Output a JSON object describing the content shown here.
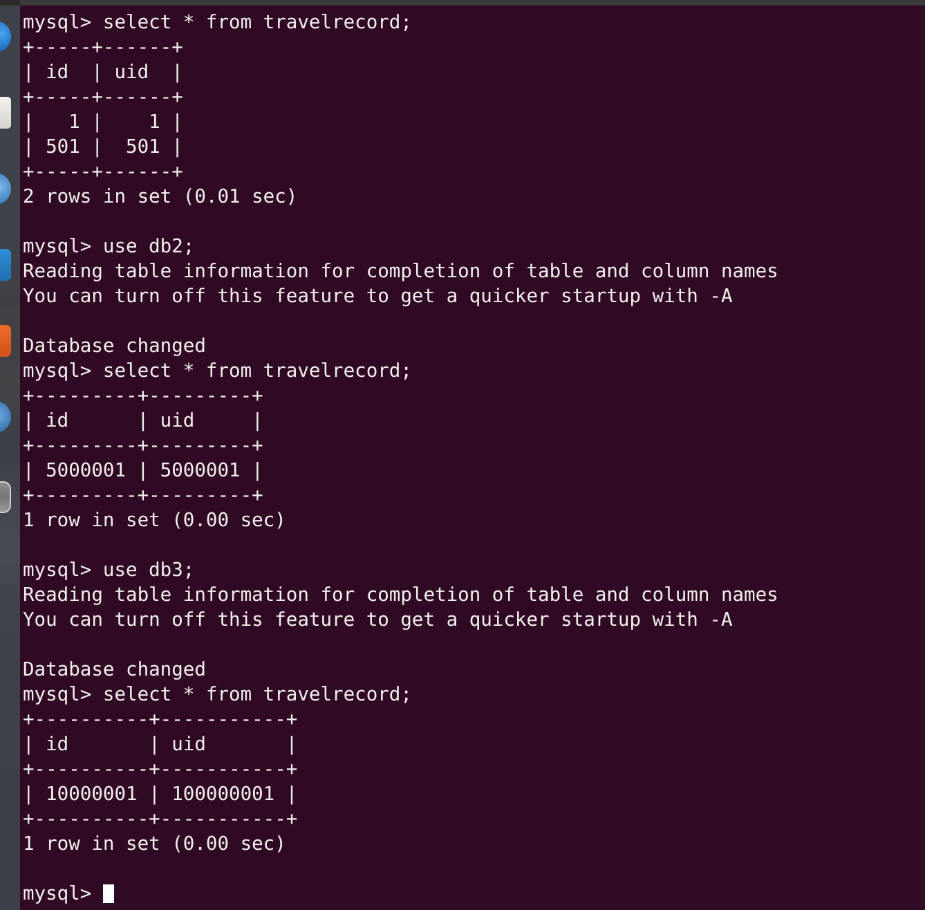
{
  "window": {
    "app": "GNOME Terminal",
    "background_color": "#300a24",
    "foreground_color": "#f2f0ec",
    "top_panel_color": "#3b3b3b"
  },
  "dock": {
    "background_color": "#3c3f46",
    "items": [
      {
        "name": "firefox",
        "label": "Firefox Web Browser",
        "color": "#1b6ec2"
      },
      {
        "name": "files",
        "label": "Files",
        "color": "#d7d3cd"
      },
      {
        "name": "rhythmbox",
        "label": "Rhythmbox",
        "color": "#3d7fbf"
      },
      {
        "name": "software",
        "label": "Ubuntu Software",
        "color": "#1f6fb0"
      },
      {
        "name": "help",
        "label": "Help",
        "color": "#f06b2a"
      },
      {
        "name": "settings",
        "label": "Settings",
        "color": "#2f6fae"
      },
      {
        "name": "terminal",
        "label": "Terminal",
        "color": "#8e8e8e"
      }
    ]
  },
  "terminal": {
    "prompt": "mysql>",
    "cursor_visible": true,
    "lines": [
      "mysql> select * from travelrecord;",
      "+-----+------+",
      "| id  | uid  |",
      "+-----+------+",
      "|   1 |    1 |",
      "| 501 |  501 |",
      "+-----+------+",
      "2 rows in set (0.01 sec)",
      "",
      "mysql> use db2;",
      "Reading table information for completion of table and column names",
      "You can turn off this feature to get a quicker startup with -A",
      "",
      "Database changed",
      "mysql> select * from travelrecord;",
      "+---------+---------+",
      "| id      | uid     |",
      "+---------+---------+",
      "| 5000001 | 5000001 |",
      "+---------+---------+",
      "1 row in set (0.00 sec)",
      "",
      "mysql> use db3;",
      "Reading table information for completion of table and column names",
      "You can turn off this feature to get a quicker startup with -A",
      "",
      "Database changed",
      "mysql> select * from travelrecord;",
      "+----------+-----------+",
      "| id       | uid       |",
      "+----------+-----------+",
      "| 10000001 | 100000001 |",
      "+----------+-----------+",
      "1 row in set (0.00 sec)",
      "",
      "mysql> "
    ],
    "commands": [
      "select * from travelrecord;",
      "use db2;",
      "select * from travelrecord;",
      "use db3;",
      "select * from travelrecord;"
    ],
    "result_sets": [
      {
        "columns": [
          "id",
          "uid"
        ],
        "rows": [
          [
            "1",
            "1"
          ],
          [
            "501",
            "501"
          ]
        ],
        "status": "2 rows in set (0.01 sec)"
      },
      {
        "columns": [
          "id",
          "uid"
        ],
        "rows": [
          [
            "5000001",
            "5000001"
          ]
        ],
        "status": "1 row in set (0.00 sec)"
      },
      {
        "columns": [
          "id",
          "uid"
        ],
        "rows": [
          [
            "10000001",
            "100000001"
          ]
        ],
        "status": "1 row in set (0.00 sec)"
      }
    ],
    "messages": [
      "Reading table information for completion of table and column names",
      "You can turn off this feature to get a quicker startup with -A",
      "Database changed"
    ]
  }
}
